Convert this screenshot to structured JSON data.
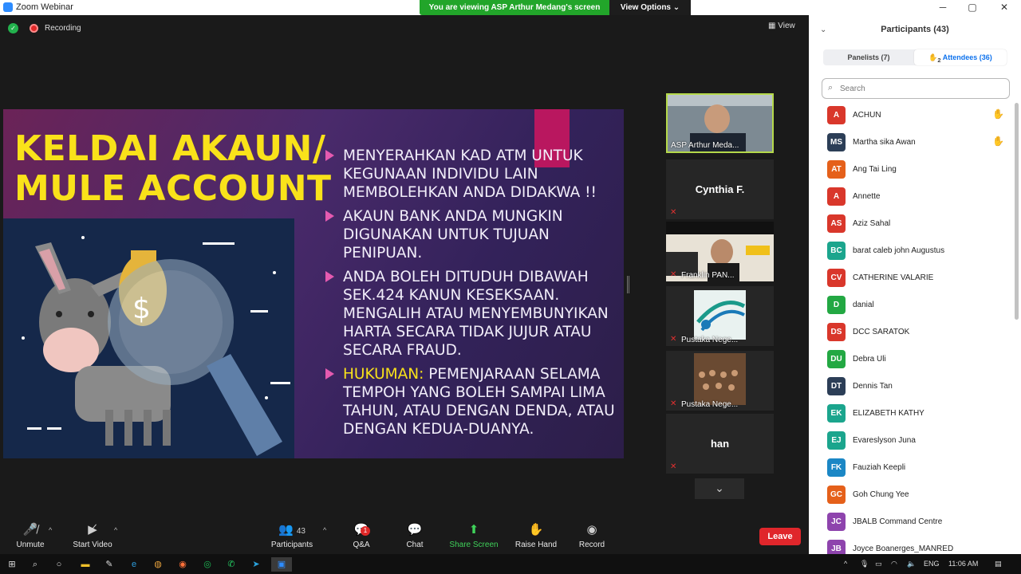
{
  "window": {
    "title": "Zoom Webinar",
    "minimize": "─",
    "maximize": "▢",
    "close": "✕"
  },
  "banner": {
    "message": "You are viewing ASP Arthur Medang's screen",
    "options_label": "View Options ⌄"
  },
  "meeting": {
    "recording_label": "Recording",
    "view_label": "View"
  },
  "slide": {
    "title_line1": "KELDAI AKAUN/",
    "title_line2": "MULE ACCOUNT",
    "bullets": [
      {
        "highlight": "",
        "text": "MENYERAHKAN KAD ATM UNTUK KEGUNAAN INDIVIDU LAIN MEMBOLEHKAN ANDA DIDAKWA !!"
      },
      {
        "highlight": "",
        "text": "AKAUN BANK ANDA MUNGKIN DIGUNAKAN UNTUK TUJUAN PENIPUAN."
      },
      {
        "highlight": "",
        "text": "ANDA BOLEH DITUDUH DIBAWAH SEK.424 KANUN KESEKSAAN. MENGALIH ATAU MENYEMBUNYIKAN HARTA SECARA TIDAK JUJUR ATAU SECARA FRAUD."
      },
      {
        "highlight": "HUKUMAN:",
        "text": " PEMENJARAAN SELAMA TEMPOH YANG BOLEH SAMPAI LIMA TAHUN, ATAU DENGAN DENDA, ATAU DENGAN KEDUA-DUANYA."
      }
    ]
  },
  "gallery": {
    "tiles": [
      {
        "name": "ASP Arthur Meda...",
        "center": ""
      },
      {
        "name": "",
        "center": "Cynthia F."
      },
      {
        "name": "Franklin PAN...",
        "center": ""
      },
      {
        "name": "Pustaka Nege...",
        "center": ""
      },
      {
        "name": "Pustaka Nege...",
        "center": ""
      },
      {
        "name": "",
        "center": "han"
      }
    ]
  },
  "toolbar": {
    "unmute": "Unmute",
    "start_video": "Start Video",
    "participants": "Participants",
    "participants_count": "43",
    "qa": "Q&A",
    "qa_badge": "1",
    "chat": "Chat",
    "share_screen": "Share Screen",
    "raise_hand": "Raise Hand",
    "record": "Record",
    "leave": "Leave"
  },
  "panel": {
    "title": "Participants (43)",
    "tab_panelists": "Panelists (7)",
    "tab_attendees": "Attendees (36)",
    "hand_count": "2",
    "search_placeholder": "Search",
    "participants": [
      {
        "initials": "A",
        "name": "ACHUN",
        "color": "#d9372b",
        "hand": true
      },
      {
        "initials": "MS",
        "name": "Martha sika Awan",
        "color": "#2c3e57",
        "hand": true
      },
      {
        "initials": "AT",
        "name": "Ang Tai Ling",
        "color": "#e5601a",
        "hand": false
      },
      {
        "initials": "A",
        "name": "Annette",
        "color": "#d9372b",
        "hand": false
      },
      {
        "initials": "AS",
        "name": "Aziz Sahal",
        "color": "#d9372b",
        "hand": false
      },
      {
        "initials": "BC",
        "name": "barat caleb john Augustus",
        "color": "#1ba58d",
        "hand": false
      },
      {
        "initials": "CV",
        "name": "CATHERINE VALARIE",
        "color": "#d9372b",
        "hand": false
      },
      {
        "initials": "D",
        "name": "danial",
        "color": "#23a843",
        "hand": false
      },
      {
        "initials": "DS",
        "name": "DCC SARATOK",
        "color": "#d9372b",
        "hand": false
      },
      {
        "initials": "DU",
        "name": "Debra Uli",
        "color": "#23a843",
        "hand": false
      },
      {
        "initials": "DT",
        "name": "Dennis Tan",
        "color": "#2c3e57",
        "hand": false
      },
      {
        "initials": "EK",
        "name": "ELIZABETH KATHY",
        "color": "#1ba58d",
        "hand": false
      },
      {
        "initials": "EJ",
        "name": "Evareslyson Juna",
        "color": "#1ba58d",
        "hand": false
      },
      {
        "initials": "FK",
        "name": "Fauziah Keepli",
        "color": "#1b87c5",
        "hand": false
      },
      {
        "initials": "GC",
        "name": "Goh Chung Yee",
        "color": "#e5601a",
        "hand": false
      },
      {
        "initials": "JC",
        "name": "JBALB Command Centre",
        "color": "#8e44ad",
        "hand": false
      },
      {
        "initials": "JB",
        "name": "Joyce Boanerges_MANRED",
        "color": "#8e44ad",
        "hand": false
      }
    ]
  },
  "taskbar": {
    "language": "ENG",
    "time": "11:06 AM"
  }
}
